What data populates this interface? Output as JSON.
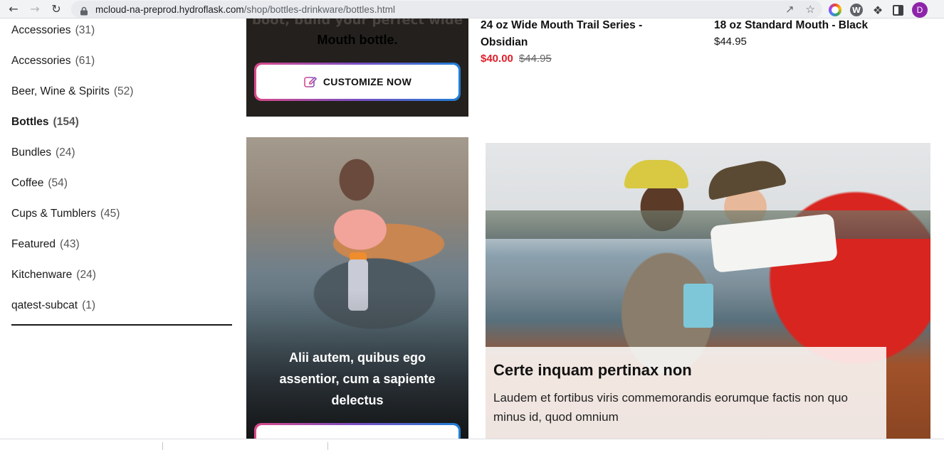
{
  "browser": {
    "url_host": "mcloud-na-preprod.hydroflask.com",
    "url_path": "/shop/bottles-drinkware/bottles.html",
    "avatar_letter": "D",
    "icons": [
      "back-icon",
      "forward-icon",
      "reload-icon",
      "lock-icon",
      "share-icon",
      "star-icon",
      "extension-color-icon",
      "extension-wp-icon",
      "puzzle-icon",
      "side-panel-icon"
    ]
  },
  "sidebar": {
    "categories": [
      {
        "label": "Accessories",
        "count": "(31)"
      },
      {
        "label": "Accessories",
        "count": "(61)"
      },
      {
        "label": "Beer, Wine & Spirits",
        "count": "(52)"
      },
      {
        "label": "Bottles",
        "count": "(154)"
      },
      {
        "label": "Bundles",
        "count": "(24)"
      },
      {
        "label": "Coffee",
        "count": "(54)"
      },
      {
        "label": "Cups & Tumblers",
        "count": "(45)"
      },
      {
        "label": "Featured",
        "count": "(43)"
      },
      {
        "label": "Kitchenware",
        "count": "(24)"
      },
      {
        "label": "qatest-subcat",
        "count": "(1)"
      }
    ],
    "active_index": 3
  },
  "promo_top": {
    "heading_line1": "boot, build your perfect wide",
    "heading_line2": "Mouth bottle.",
    "cta_label": "CUSTOMIZE NOW"
  },
  "products": [
    {
      "name_line1": "24 oz Wide Mouth Trail Series -",
      "name_line2": "Obsidian",
      "sale_price": "$40.00",
      "original_price": "$44.95"
    },
    {
      "name_line1": "18 oz Standard Mouth - Black",
      "price": "$44.95"
    }
  ],
  "photo_tile_1": {
    "caption": "Alii autem, quibus ego assentior, cum a sapiente delectus"
  },
  "photo_tile_2": {
    "title": "Certe inquam pertinax non",
    "body": "Laudem et fortibus viris commemorandis eorumque factis non quo minus id, quod omnium"
  },
  "colors": {
    "sale_red": "#e0202c",
    "cta_gradient": [
      "#d94a8a",
      "#7a4fc4",
      "#1f7fd6"
    ],
    "avatar_purple": "#8e24aa"
  }
}
